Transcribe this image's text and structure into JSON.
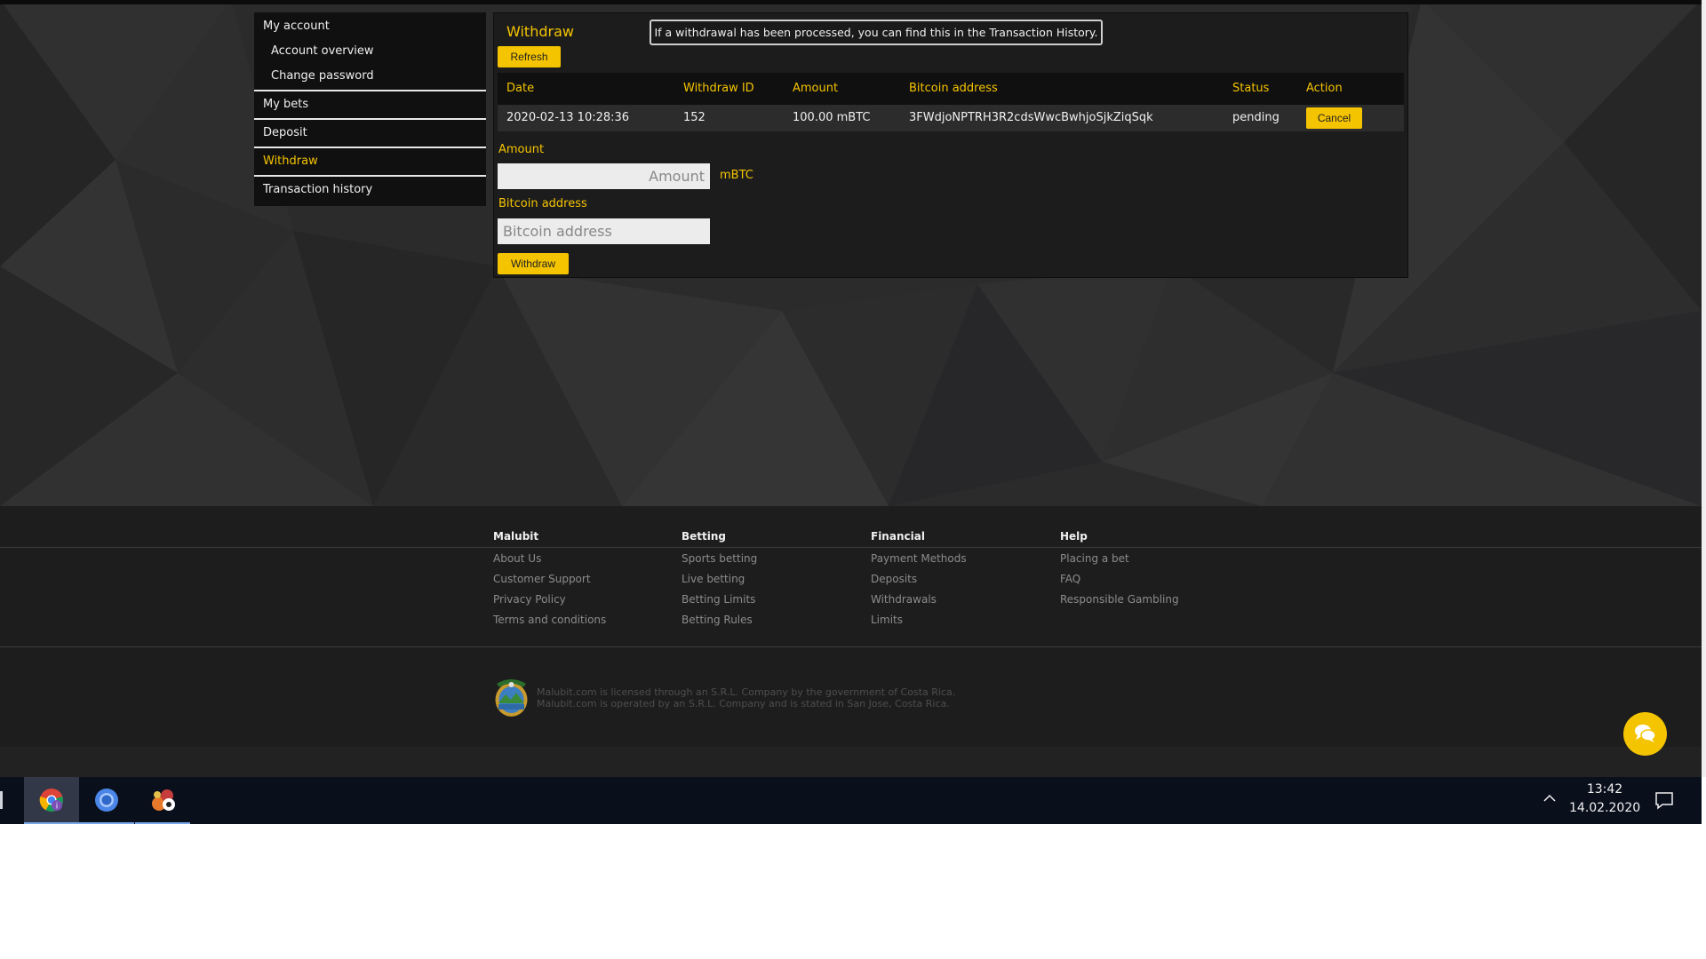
{
  "sidebar": {
    "my_account": "My account",
    "account_overview": "Account overview",
    "change_password": "Change password",
    "my_bets": "My bets",
    "deposit": "Deposit",
    "withdraw": "Withdraw",
    "transaction_history": "Transaction history"
  },
  "withdraw_panel": {
    "title": "Withdraw",
    "notice": "If a withdrawal has been processed, you can find this in the Transaction History.",
    "refresh_label": "Refresh",
    "table": {
      "headers": [
        "Date",
        "Withdraw ID",
        "Amount",
        "Bitcoin address",
        "Status",
        "Action"
      ],
      "rows": [
        {
          "date": "2020-02-13 10:28:36",
          "id": "152",
          "amount": "100.00 mBTC",
          "address": "3FWdjoNPTRH3R2cdsWwcBwhjoSjkZiqSqk",
          "status": "pending",
          "action_label": "Cancel"
        }
      ]
    },
    "amount_label": "Amount",
    "amount_placeholder": "Amount",
    "amount_unit": "mBTC",
    "address_label": "Bitcoin address",
    "address_placeholder": "Bitcoin address",
    "withdraw_button": "Withdraw"
  },
  "footer": {
    "columns": [
      {
        "heading": "Malubit",
        "links": [
          "About Us",
          "Customer Support",
          "Privacy Policy",
          "Terms and conditions"
        ]
      },
      {
        "heading": "Betting",
        "links": [
          "Sports betting",
          "Live betting",
          "Betting Limits",
          "Betting Rules"
        ]
      },
      {
        "heading": "Financial",
        "links": [
          "Payment Methods",
          "Deposits",
          "Withdrawals",
          "Limits"
        ]
      },
      {
        "heading": "Help",
        "links": [
          "Placing a bet",
          "FAQ",
          "Responsible Gambling"
        ]
      }
    ],
    "license_line1": "Malubit.com is licensed through an S.R.L. Company by the government of Costa Rica.",
    "license_line2": "Malubit.com is operated by an S.R.L. Company and is stated in San Jose, Costa Rica."
  },
  "taskbar": {
    "apps": [
      "chrome-icon",
      "chromium-icon",
      "game-icon"
    ],
    "time": "13:42",
    "date": "14.02.2020"
  },
  "colors": {
    "accent": "#f5c400",
    "panel_bg": "#1c1c1c",
    "sidebar_bg": "#101010",
    "footer_bg": "#1d1d1d",
    "taskbar_bg": "#0a0f1c"
  }
}
